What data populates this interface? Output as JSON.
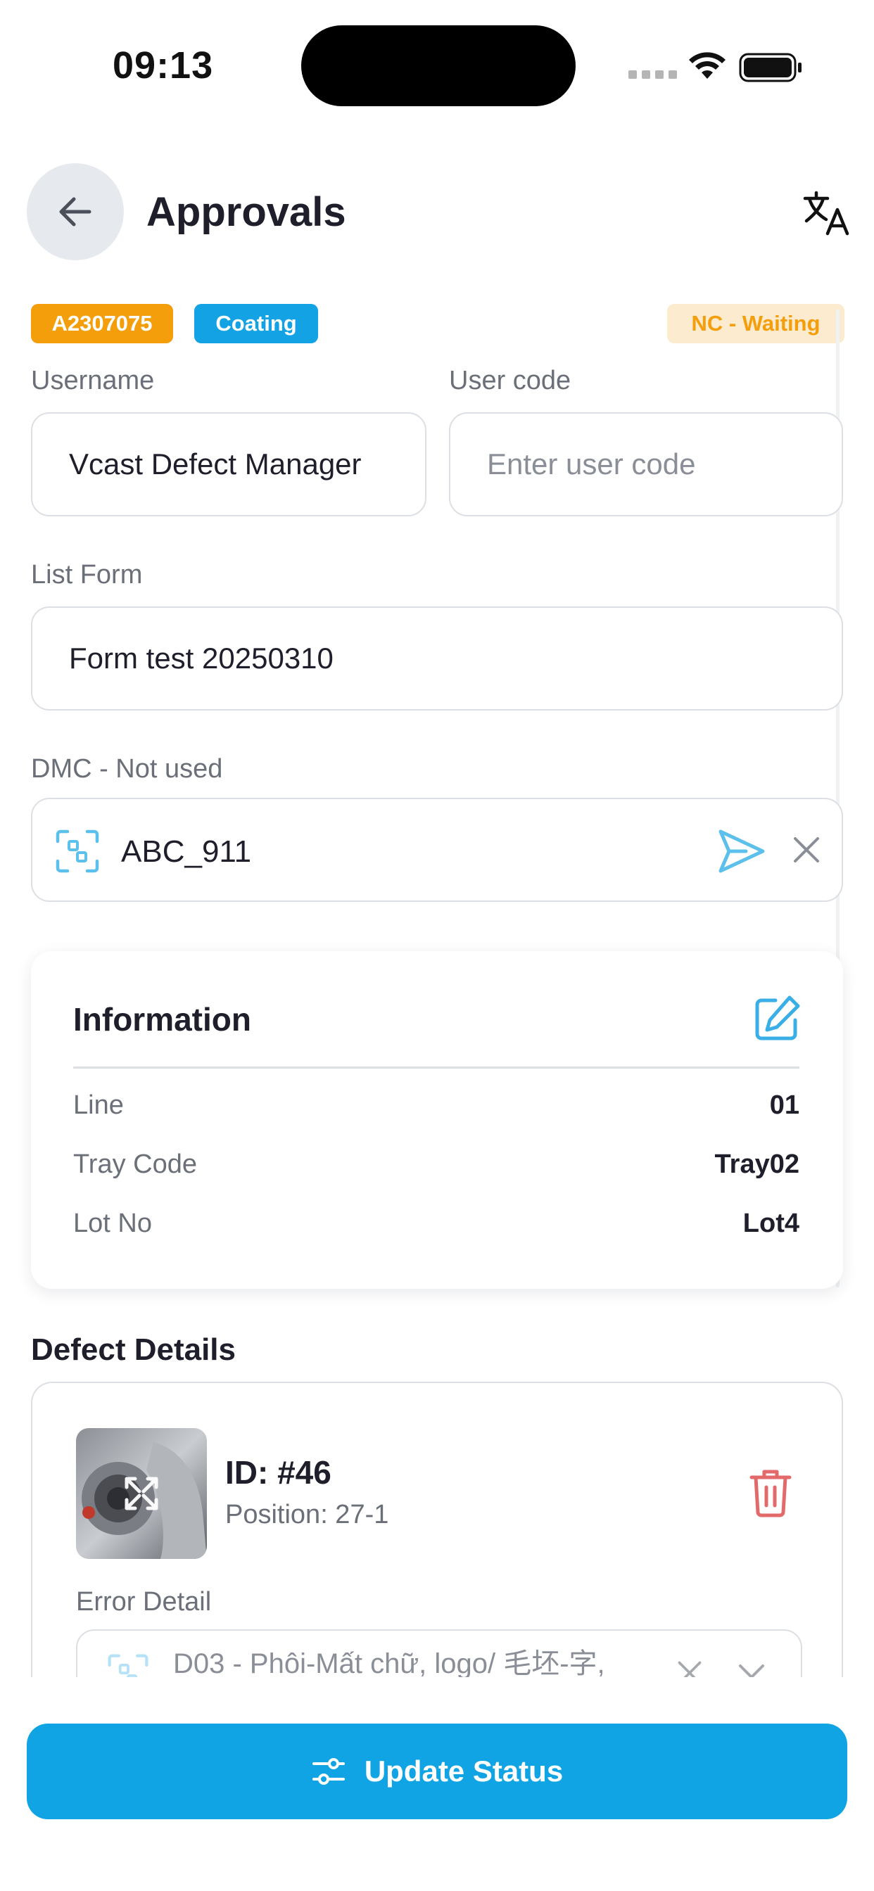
{
  "status_bar": {
    "time": "09:13"
  },
  "header": {
    "title": "Approvals"
  },
  "badges": {
    "id": "A2307075",
    "stage": "Coating",
    "status": "NC - Waiting"
  },
  "form": {
    "username_label": "Username",
    "username_value": "Vcast Defect Manager",
    "user_code_label": "User code",
    "user_code_placeholder": "Enter user code",
    "list_form_label": "List Form",
    "list_form_value": "Form test 20250310",
    "dmc_label": "DMC - Not used",
    "dmc_value": "ABC_911"
  },
  "information": {
    "title": "Information",
    "rows": [
      {
        "key": "Line",
        "value": "01"
      },
      {
        "key": "Tray Code",
        "value": "Tray02"
      },
      {
        "key": "Lot No",
        "value": "Lot4"
      }
    ]
  },
  "defect_details": {
    "title": "Defect Details",
    "item": {
      "id": "ID: #46",
      "position": "Position: 27-1",
      "error_label": "Error Detail",
      "error_value": "D03 - Phôi-Mất chữ, logo/ 毛坯-字,"
    }
  },
  "footer": {
    "update_button_label": "Update Status"
  },
  "colors": {
    "primary": "#11a4e4",
    "badge_id": "#f59e0b",
    "badge_stage": "#13a3e4",
    "badge_status_bg": "#fdebd0",
    "delete_icon": "#e36a6a"
  }
}
